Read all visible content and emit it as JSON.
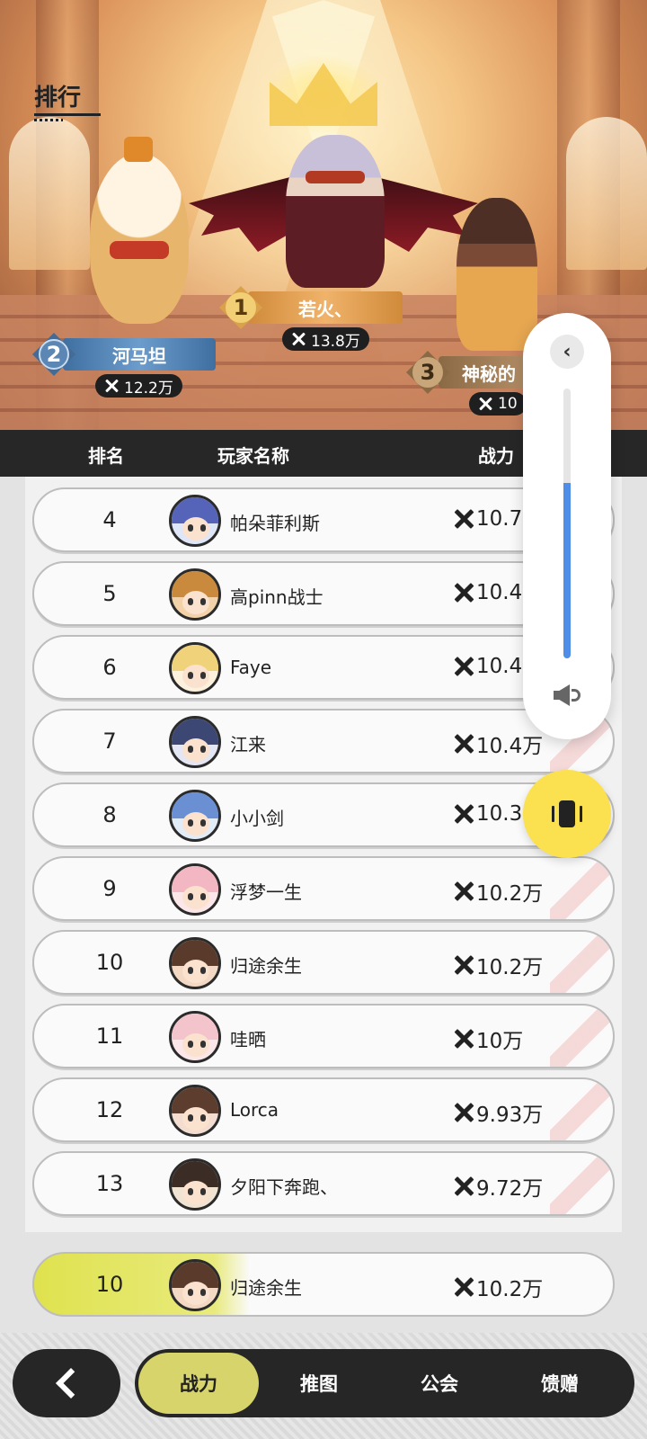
{
  "page": {
    "title": "排行"
  },
  "podium": [
    {
      "rank": "1",
      "name": "若火、",
      "power": "13.8万"
    },
    {
      "rank": "2",
      "name": "河马坦",
      "power": "12.2万"
    },
    {
      "rank": "3",
      "name": "神秘的",
      "power": "10"
    }
  ],
  "table": {
    "headers": {
      "rank": "排名",
      "name": "玩家名称",
      "power": "战力"
    },
    "rows": [
      {
        "rank": "4",
        "name": "帕朵菲利斯",
        "power": "10.7"
      },
      {
        "rank": "5",
        "name": "高pinn战士",
        "power": "10.4"
      },
      {
        "rank": "6",
        "name": "Faye",
        "power": "10.4"
      },
      {
        "rank": "7",
        "name": "江来",
        "power": "10.4万"
      },
      {
        "rank": "8",
        "name": "小小剑",
        "power": "10.3"
      },
      {
        "rank": "9",
        "name": "浮梦一生",
        "power": "10.2万"
      },
      {
        "rank": "10",
        "name": "归途余生",
        "power": "10.2万"
      },
      {
        "rank": "11",
        "name": "哇晒",
        "power": "10万"
      },
      {
        "rank": "12",
        "name": "Lorca",
        "power": "9.93万"
      },
      {
        "rank": "13",
        "name": "夕阳下奔跑、",
        "power": "9.72万"
      }
    ]
  },
  "self": {
    "rank": "10",
    "name": "归途余生",
    "power": "10.2万"
  },
  "volume": {
    "level_fraction": 0.65
  },
  "nav": {
    "tabs": [
      "战力",
      "推图",
      "公会",
      "馈赠"
    ],
    "active_tab": "战力"
  },
  "colors": {
    "header_bg": "#272727",
    "active_tab": "#d6d46a",
    "self_highlight": "#dfe24e",
    "volume_fill": "#4f8ee8",
    "vibrate_button": "#fbe04f"
  },
  "icons": {
    "power": "crossed-swords-icon",
    "back": "chevron-left-icon",
    "volume": "speaker-icon",
    "vibrate": "vibrate-icon"
  }
}
